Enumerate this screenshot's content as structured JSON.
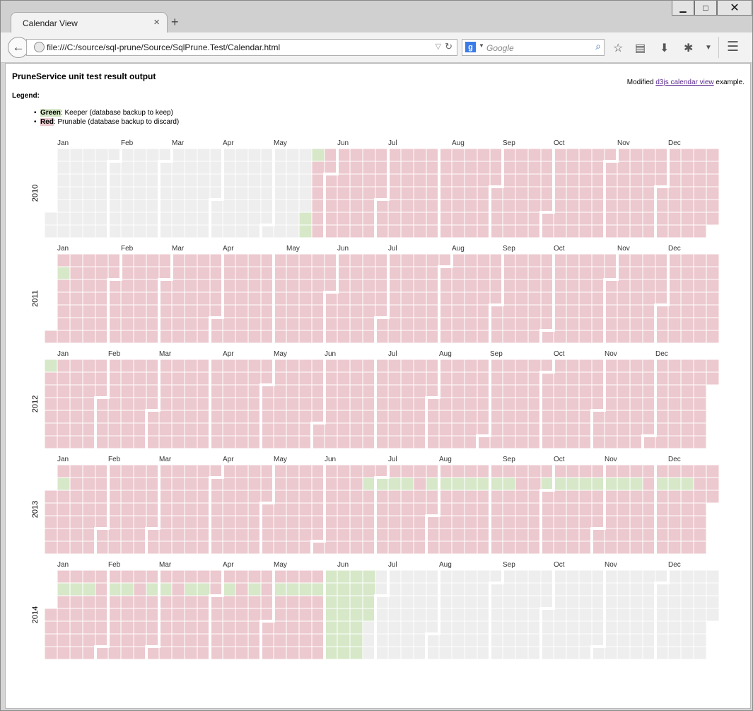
{
  "browser": {
    "tab_title": "Calendar View",
    "tab_close": "×",
    "new_tab": "+",
    "window_buttons": {
      "minimize": "▁",
      "maximize": "□",
      "close": "✕"
    },
    "back": "←",
    "url": "file:///C:/source/sql-prune/Source/SqlPrune.Test/Calendar.html",
    "url_dropdown": "▽",
    "reload": "↻",
    "search_engine": "g",
    "search_placeholder": "Google",
    "icons": [
      "back-arrow-icon",
      "globe-icon",
      "reload-icon",
      "search-magnifier-icon",
      "star-icon",
      "reading-list-icon",
      "download-icon",
      "addon-icon",
      "dropdown-icon",
      "menu-icon"
    ]
  },
  "page": {
    "title": "PruneService unit test result output",
    "modified_prefix": "Modified",
    "modified_link": "d3js calendar view",
    "modified_suffix": "example.",
    "legend_heading": "Legend:",
    "legend": [
      {
        "swatch": "Green",
        "text": ": Keeper (database backup to keep)"
      },
      {
        "swatch": "Red",
        "text": ": Prunable (database backup to discard)"
      }
    ]
  },
  "colors": {
    "keeper": "#d6e8c8",
    "prunable": "#ecc9cf",
    "nodata": "#eeeeee",
    "cell_border": "#ffffff",
    "month_boundary": "#ffffff"
  },
  "chart_data": {
    "type": "heatmap",
    "layout": "calendar, one block per year, rows = weekday (Sun to Sat), columns = weeks",
    "month_labels": [
      "Jan",
      "Feb",
      "Mar",
      "Apr",
      "May",
      "Jun",
      "Jul",
      "Aug",
      "Sep",
      "Oct",
      "Nov",
      "Dec"
    ],
    "years": [
      {
        "year": "2010",
        "status_runs": [
          {
            "from": "2010-01-01",
            "to": "2010-05-20",
            "status": "nodata"
          },
          {
            "from": "2010-05-21",
            "to": "2010-05-23",
            "status": "keeper"
          },
          {
            "from": "2010-05-24",
            "to": "2010-12-31",
            "status": "prunable"
          }
        ]
      },
      {
        "year": "2011",
        "status_runs": [
          {
            "from": "2011-01-01",
            "to": "2011-01-02",
            "status": "prunable"
          },
          {
            "from": "2011-01-03",
            "to": "2011-01-03",
            "status": "keeper"
          },
          {
            "from": "2011-01-04",
            "to": "2011-12-31",
            "status": "prunable"
          }
        ]
      },
      {
        "year": "2012",
        "status_runs": [
          {
            "from": "2012-01-01",
            "to": "2012-01-01",
            "status": "keeper"
          },
          {
            "from": "2012-01-02",
            "to": "2012-12-31",
            "status": "prunable"
          }
        ]
      },
      {
        "year": "2013",
        "status_runs": [
          {
            "from": "2013-01-01",
            "to": "2013-12-31",
            "status": "prunable"
          }
        ],
        "keeper_days": [
          "2013-01-07",
          "2013-06-24",
          "2013-07-01",
          "2013-07-08",
          "2013-07-15",
          "2013-07-29",
          "2013-08-05",
          "2013-08-12",
          "2013-08-19",
          "2013-08-26",
          "2013-09-02",
          "2013-09-09",
          "2013-09-30",
          "2013-10-07",
          "2013-10-14",
          "2013-10-21",
          "2013-10-28",
          "2013-11-04",
          "2013-11-11",
          "2013-11-18",
          "2013-12-02",
          "2013-12-09",
          "2013-12-16"
        ]
      },
      {
        "year": "2014",
        "status_runs": [
          {
            "from": "2014-01-01",
            "to": "2014-05-31",
            "status": "prunable"
          },
          {
            "from": "2014-06-01",
            "to": "2014-06-25",
            "status": "keeper"
          },
          {
            "from": "2014-06-26",
            "to": "2014-12-31",
            "status": "nodata"
          }
        ],
        "keeper_days": [
          "2014-01-06",
          "2014-01-13",
          "2014-01-20",
          "2014-02-03",
          "2014-02-10",
          "2014-02-24",
          "2014-03-03",
          "2014-03-17",
          "2014-03-24",
          "2014-04-07",
          "2014-04-21",
          "2014-05-05",
          "2014-05-12",
          "2014-05-19",
          "2014-05-26",
          "2014-06-02",
          "2014-06-09",
          "2014-06-16",
          "2014-06-23"
        ]
      }
    ]
  }
}
